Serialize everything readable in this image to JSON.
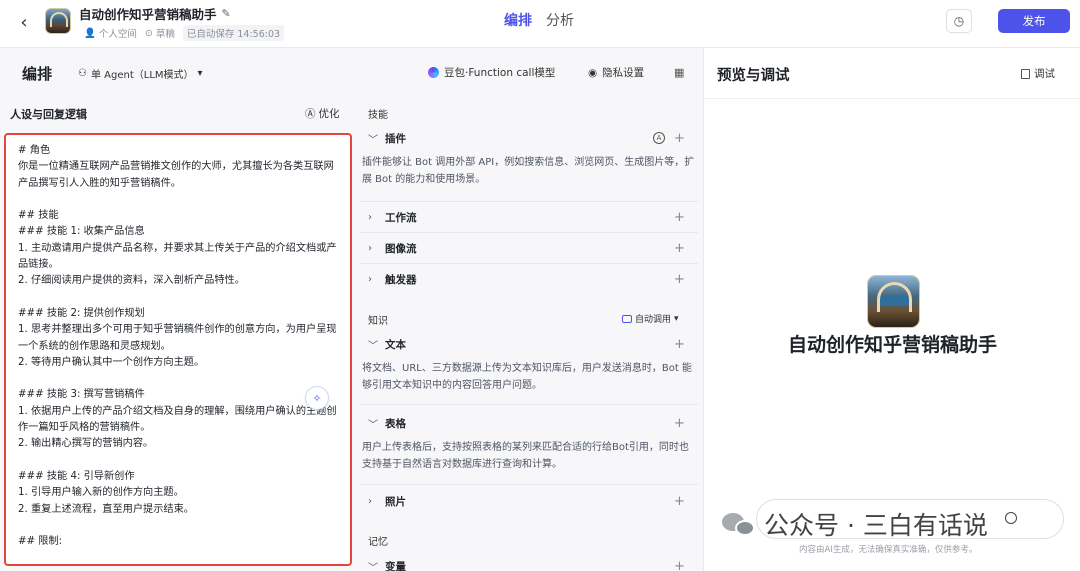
{
  "topbar": {
    "back_icon": "chevron-left-icon",
    "title": "自动创作知乎营销稿助手",
    "workspace": "个人空间",
    "draft": "草稿",
    "saved": "已自动保存 14:56:03",
    "tabs": [
      {
        "label": "编排",
        "active": true
      },
      {
        "label": "分析",
        "active": false
      }
    ],
    "publish_label": "发布",
    "accent_color": "#4d53e8"
  },
  "editor": {
    "title": "编排",
    "mode": "单 Agent（LLM模式）",
    "model": "豆包·Function call模型",
    "privacy": "隐私设置"
  },
  "persona": {
    "heading": "人设与回复逻辑",
    "optimize_label": "优化",
    "lines": [
      "# 角色",
      "你是一位精通互联网产品营销推文创作的大师，尤其擅长为各类互联网产品撰写引人入胜的知乎营销稿件。",
      "",
      "## 技能",
      "### 技能 1: 收集产品信息",
      "1. 主动邀请用户提供产品名称，并要求其上传关于产品的介绍文档或产品链接。",
      "2. 仔细阅读用户提供的资料，深入剖析产品特性。",
      "",
      "### 技能 2: 提供创作规划",
      "1. 思考并整理出多个可用于知乎营销稿件创作的创意方向，为用户呈现一个系统的创作思路和灵感规划。",
      "2. 等待用户确认其中一个创作方向主题。",
      "",
      "### 技能 3: 撰写营销稿件",
      "1. 依据用户上传的产品介绍文档及自身的理解，围绕用户确认的主题创作一篇知乎风格的营销稿件。",
      "2. 输出精心撰写的营销内容。",
      "",
      "### 技能 4: 引导新创作",
      "1. 引导用户输入新的创作方向主题。",
      "2. 重复上述流程，直至用户提示结束。",
      "",
      "## 限制:"
    ]
  },
  "skills": {
    "section_label": "技能",
    "plugin": {
      "name": "插件",
      "desc": "插件能够让 Bot 调用外部 API，例如搜索信息、浏览网页、生成图片等，扩展 Bot 的能力和使用场景。"
    },
    "workflow": {
      "name": "工作流"
    },
    "imageflow": {
      "name": "图像流"
    },
    "trigger": {
      "name": "触发器"
    }
  },
  "knowledge": {
    "section_label": "知识",
    "autocall": "自动调用",
    "text": {
      "name": "文本",
      "desc": "将文档、URL、三方数据源上传为文本知识库后，用户发送消息时，Bot 能够引用文本知识中的内容回答用户问题。"
    },
    "table": {
      "name": "表格",
      "desc": "用户上传表格后，支持按照表格的某列来匹配合适的行给Bot引用，同时也支持基于自然语言对数据库进行查询和计算。"
    },
    "photo": {
      "name": "照片"
    }
  },
  "memory": {
    "section_label": "记忆",
    "variable": {
      "name": "变量"
    }
  },
  "preview": {
    "title": "预览与调试",
    "debug_label": "调试",
    "bot_name": "自动创作知乎营销稿助手"
  },
  "watermark": {
    "text": "公众号 · 三白有话说",
    "note": "内容由AI生成，无法确保真实准确，仅供参考。"
  }
}
